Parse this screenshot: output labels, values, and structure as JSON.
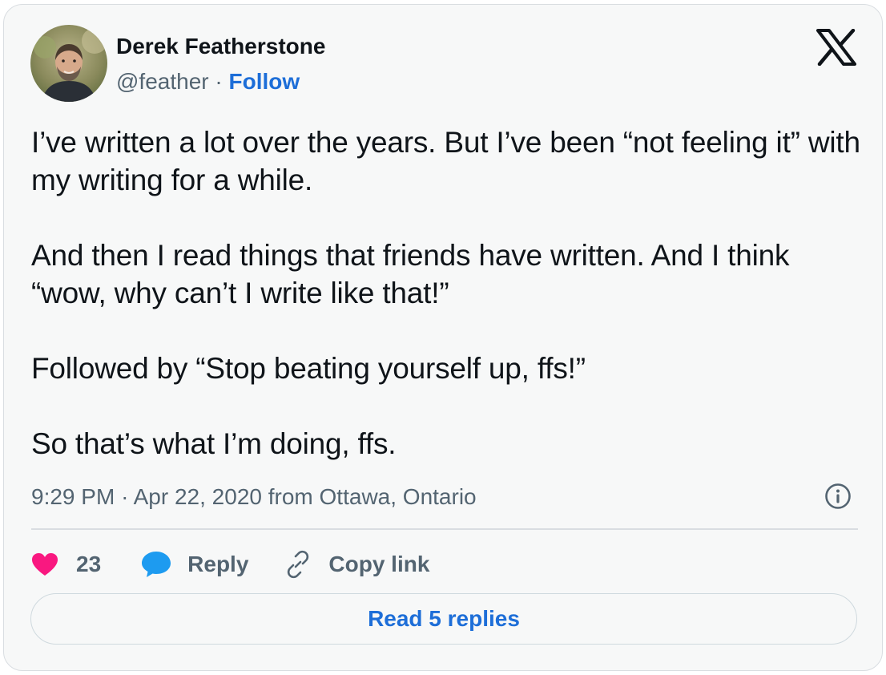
{
  "author": {
    "name": "Derek Featherstone",
    "handle": "@feather",
    "separator": "·",
    "follow_label": "Follow"
  },
  "tweet": {
    "paragraphs": [
      "I’ve written a lot over the years. But I’ve been “not feeling it” with my writing for a while.",
      "And then I read things that friends have written. And I think “wow, why can’t I write like that!”",
      "Followed by “Stop beating yourself up, ffs!”",
      "So that’s what I’m doing, ffs."
    ]
  },
  "meta": {
    "time": "9:29 PM",
    "separator": "·",
    "date": "Apr 22, 2020",
    "location_prefix": "from",
    "location": "Ottawa, Ontario"
  },
  "actions": {
    "like_count": "23",
    "reply_label": "Reply",
    "copy_link_label": "Copy link"
  },
  "read_replies_label": "Read 5 replies",
  "icons": {
    "brand": "x-logo-icon",
    "info": "info-icon",
    "like": "heart-icon",
    "reply": "speech-bubble-icon",
    "copy": "link-icon"
  },
  "colors": {
    "accent_link": "#1d6ed8",
    "like_heart": "#f91880",
    "reply_bubble": "#1d9bf0",
    "secondary_text": "#536471",
    "card_background": "#f7f8f8"
  }
}
